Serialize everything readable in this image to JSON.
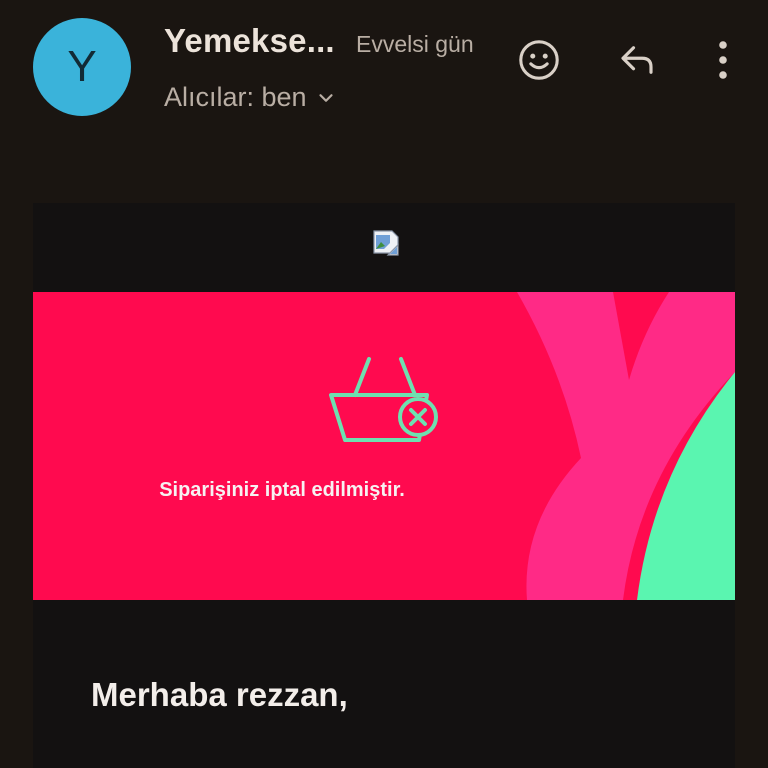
{
  "header": {
    "avatar_letter": "Y",
    "sender": "Yemekse...",
    "date": "Evvelsi gün",
    "recipients_label": "Alıcılar: ben"
  },
  "actions": {
    "emoji_icon": "smiley-icon",
    "reply_icon": "reply-icon",
    "more_icon": "more-vert-icon"
  },
  "email": {
    "banner_message": "Siparişiniz iptal edilmiştir.",
    "greeting": "Merhaba rezzan,"
  },
  "colors": {
    "background": "#1a1511",
    "avatar": "#3ab3da",
    "banner": "#ff0a4f",
    "banner_stripe": "#ff2a86",
    "banner_accent": "#5af5b0",
    "basket_icon": "#6ee0b0"
  }
}
